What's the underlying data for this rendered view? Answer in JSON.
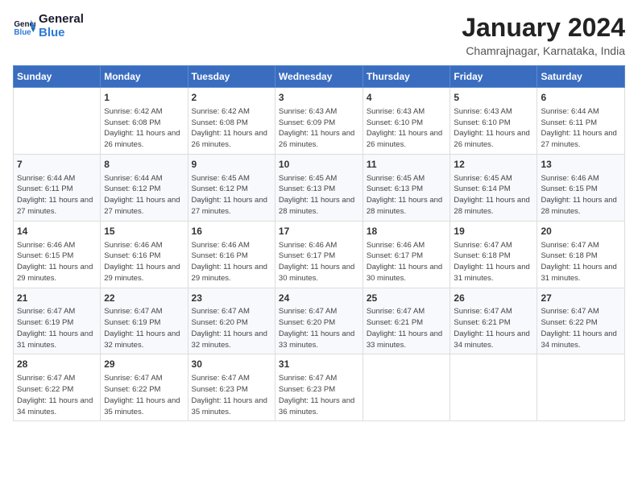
{
  "header": {
    "logo_text_general": "General",
    "logo_text_blue": "Blue",
    "main_title": "January 2024",
    "subtitle": "Chamrajnagar, Karnataka, India"
  },
  "days_of_week": [
    "Sunday",
    "Monday",
    "Tuesday",
    "Wednesday",
    "Thursday",
    "Friday",
    "Saturday"
  ],
  "weeks": [
    [
      {
        "day": "",
        "info": ""
      },
      {
        "day": "1",
        "info": "Sunrise: 6:42 AM\nSunset: 6:08 PM\nDaylight: 11 hours and 26 minutes."
      },
      {
        "day": "2",
        "info": "Sunrise: 6:42 AM\nSunset: 6:08 PM\nDaylight: 11 hours and 26 minutes."
      },
      {
        "day": "3",
        "info": "Sunrise: 6:43 AM\nSunset: 6:09 PM\nDaylight: 11 hours and 26 minutes."
      },
      {
        "day": "4",
        "info": "Sunrise: 6:43 AM\nSunset: 6:10 PM\nDaylight: 11 hours and 26 minutes."
      },
      {
        "day": "5",
        "info": "Sunrise: 6:43 AM\nSunset: 6:10 PM\nDaylight: 11 hours and 26 minutes."
      },
      {
        "day": "6",
        "info": "Sunrise: 6:44 AM\nSunset: 6:11 PM\nDaylight: 11 hours and 27 minutes."
      }
    ],
    [
      {
        "day": "7",
        "info": "Sunrise: 6:44 AM\nSunset: 6:11 PM\nDaylight: 11 hours and 27 minutes."
      },
      {
        "day": "8",
        "info": "Sunrise: 6:44 AM\nSunset: 6:12 PM\nDaylight: 11 hours and 27 minutes."
      },
      {
        "day": "9",
        "info": "Sunrise: 6:45 AM\nSunset: 6:12 PM\nDaylight: 11 hours and 27 minutes."
      },
      {
        "day": "10",
        "info": "Sunrise: 6:45 AM\nSunset: 6:13 PM\nDaylight: 11 hours and 28 minutes."
      },
      {
        "day": "11",
        "info": "Sunrise: 6:45 AM\nSunset: 6:13 PM\nDaylight: 11 hours and 28 minutes."
      },
      {
        "day": "12",
        "info": "Sunrise: 6:45 AM\nSunset: 6:14 PM\nDaylight: 11 hours and 28 minutes."
      },
      {
        "day": "13",
        "info": "Sunrise: 6:46 AM\nSunset: 6:15 PM\nDaylight: 11 hours and 28 minutes."
      }
    ],
    [
      {
        "day": "14",
        "info": "Sunrise: 6:46 AM\nSunset: 6:15 PM\nDaylight: 11 hours and 29 minutes."
      },
      {
        "day": "15",
        "info": "Sunrise: 6:46 AM\nSunset: 6:16 PM\nDaylight: 11 hours and 29 minutes."
      },
      {
        "day": "16",
        "info": "Sunrise: 6:46 AM\nSunset: 6:16 PM\nDaylight: 11 hours and 29 minutes."
      },
      {
        "day": "17",
        "info": "Sunrise: 6:46 AM\nSunset: 6:17 PM\nDaylight: 11 hours and 30 minutes."
      },
      {
        "day": "18",
        "info": "Sunrise: 6:46 AM\nSunset: 6:17 PM\nDaylight: 11 hours and 30 minutes."
      },
      {
        "day": "19",
        "info": "Sunrise: 6:47 AM\nSunset: 6:18 PM\nDaylight: 11 hours and 31 minutes."
      },
      {
        "day": "20",
        "info": "Sunrise: 6:47 AM\nSunset: 6:18 PM\nDaylight: 11 hours and 31 minutes."
      }
    ],
    [
      {
        "day": "21",
        "info": "Sunrise: 6:47 AM\nSunset: 6:19 PM\nDaylight: 11 hours and 31 minutes."
      },
      {
        "day": "22",
        "info": "Sunrise: 6:47 AM\nSunset: 6:19 PM\nDaylight: 11 hours and 32 minutes."
      },
      {
        "day": "23",
        "info": "Sunrise: 6:47 AM\nSunset: 6:20 PM\nDaylight: 11 hours and 32 minutes."
      },
      {
        "day": "24",
        "info": "Sunrise: 6:47 AM\nSunset: 6:20 PM\nDaylight: 11 hours and 33 minutes."
      },
      {
        "day": "25",
        "info": "Sunrise: 6:47 AM\nSunset: 6:21 PM\nDaylight: 11 hours and 33 minutes."
      },
      {
        "day": "26",
        "info": "Sunrise: 6:47 AM\nSunset: 6:21 PM\nDaylight: 11 hours and 34 minutes."
      },
      {
        "day": "27",
        "info": "Sunrise: 6:47 AM\nSunset: 6:22 PM\nDaylight: 11 hours and 34 minutes."
      }
    ],
    [
      {
        "day": "28",
        "info": "Sunrise: 6:47 AM\nSunset: 6:22 PM\nDaylight: 11 hours and 34 minutes."
      },
      {
        "day": "29",
        "info": "Sunrise: 6:47 AM\nSunset: 6:22 PM\nDaylight: 11 hours and 35 minutes."
      },
      {
        "day": "30",
        "info": "Sunrise: 6:47 AM\nSunset: 6:23 PM\nDaylight: 11 hours and 35 minutes."
      },
      {
        "day": "31",
        "info": "Sunrise: 6:47 AM\nSunset: 6:23 PM\nDaylight: 11 hours and 36 minutes."
      },
      {
        "day": "",
        "info": ""
      },
      {
        "day": "",
        "info": ""
      },
      {
        "day": "",
        "info": ""
      }
    ]
  ]
}
